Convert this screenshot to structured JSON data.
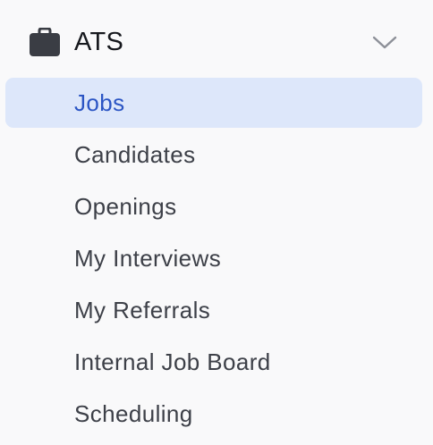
{
  "section": {
    "title": "ATS",
    "icon": "briefcase-icon",
    "toggle_icon": "chevron-down-icon",
    "expanded": true
  },
  "colors": {
    "background": "#f9f9fa",
    "active_background": "#dde7fa",
    "active_text": "#2b55c4",
    "text": "#3d4048"
  },
  "nav": {
    "items": [
      {
        "label": "Jobs",
        "active": true
      },
      {
        "label": "Candidates",
        "active": false
      },
      {
        "label": "Openings",
        "active": false
      },
      {
        "label": "My Interviews",
        "active": false
      },
      {
        "label": "My Referrals",
        "active": false
      },
      {
        "label": "Internal Job Board",
        "active": false
      },
      {
        "label": "Scheduling",
        "active": false
      }
    ]
  }
}
